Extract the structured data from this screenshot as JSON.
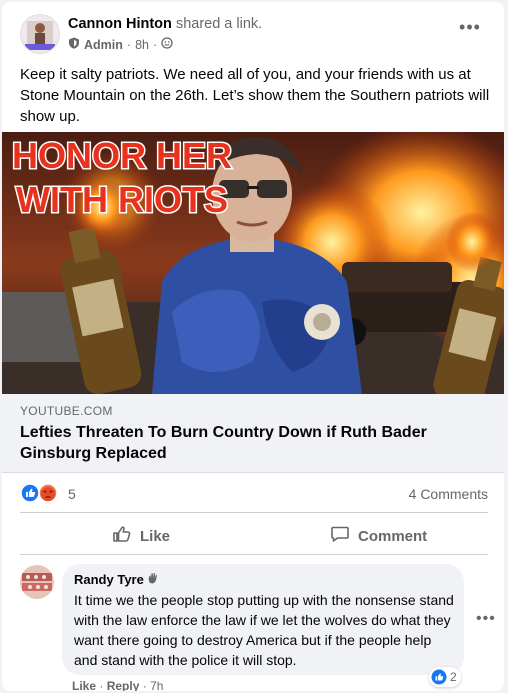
{
  "post": {
    "author": "Cannon Hinton",
    "action": "shared a link.",
    "role": "Admin",
    "time": "8h",
    "separator": "·",
    "more_label": "•••",
    "text": "Keep it salty patriots. We need all of you, and your friends with us at Stone Mountain on the 26th. Let’s show them the Southern patriots will show up."
  },
  "link": {
    "image_caption_line1": "HONOR HER",
    "image_caption_line2": "WITH RIOTS",
    "domain": "YOUTUBE.COM",
    "title": "Lefties Threaten To Burn Country Down if Ruth Bader Ginsburg Replaced"
  },
  "stats": {
    "reaction_count": "5",
    "comments": "4 Comments"
  },
  "actions": {
    "like": "Like",
    "comment": "Comment"
  },
  "comment": {
    "author": "Randy Tyre",
    "text": "It time we the people stop putting up with the nonsense stand with the law enforce the law if we let the wolves do what they want there going to destroy America but if the people help and stand with the police it will stop.",
    "reaction_count": "2",
    "like_label": "Like",
    "reply_label": "Reply",
    "time": "7h",
    "separator": "·"
  },
  "colors": {
    "like_blue": "#1877f2",
    "angry_orange": "#f7714a",
    "secondary_text": "#65676b",
    "caption_red": "#e8321e"
  },
  "icons": [
    "shield-icon",
    "globe-icon",
    "more-icon",
    "like-reaction-icon",
    "angry-reaction-icon",
    "thumbs-up-icon",
    "comment-icon",
    "wave-icon"
  ]
}
